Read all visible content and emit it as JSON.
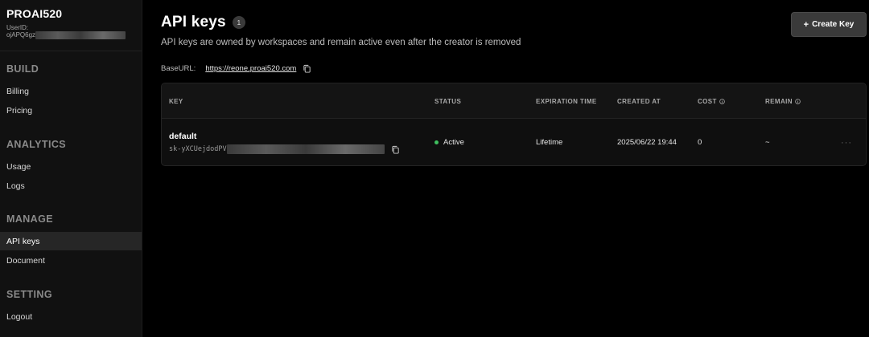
{
  "brand": {
    "name": "PROAI520",
    "user_id_label": "UserID:",
    "user_id_prefix": "ojAPQ6gz"
  },
  "sidebar": {
    "sections": [
      {
        "title": "BUILD",
        "items": [
          "Billing",
          "Pricing"
        ]
      },
      {
        "title": "ANALYTICS",
        "items": [
          "Usage",
          "Logs"
        ]
      },
      {
        "title": "MANAGE",
        "items": [
          "API keys",
          "Document"
        ]
      },
      {
        "title": "SETTING",
        "items": [
          "Logout"
        ]
      }
    ],
    "active_item": "API keys"
  },
  "header": {
    "title": "API keys",
    "count": "1",
    "subtitle": "API keys are owned by workspaces and remain active even after the creator is removed",
    "baseurl_label": "BaseURL:",
    "baseurl": "https://reone.proai520.com",
    "create_button": "Create Key"
  },
  "table": {
    "columns": [
      "KEY",
      "STATUS",
      "EXPIRATION TIME",
      "CREATED AT",
      "COST",
      "REMAIN"
    ],
    "rows": [
      {
        "name": "default",
        "key_prefix": "sk-yXCUejdodPV",
        "status": "Active",
        "expiration": "Lifetime",
        "created_at": "2025/06/22 19:44",
        "cost": "0",
        "remain": "~"
      }
    ]
  },
  "colors": {
    "background": "#000000",
    "sidebar": "#111111",
    "active_status": "#3fbf5f",
    "button": "#3a3a3a"
  },
  "icons": {
    "copy": "copy-icon",
    "info": "info-icon",
    "more": "more-horizontal-icon",
    "plus": "plus-icon"
  }
}
